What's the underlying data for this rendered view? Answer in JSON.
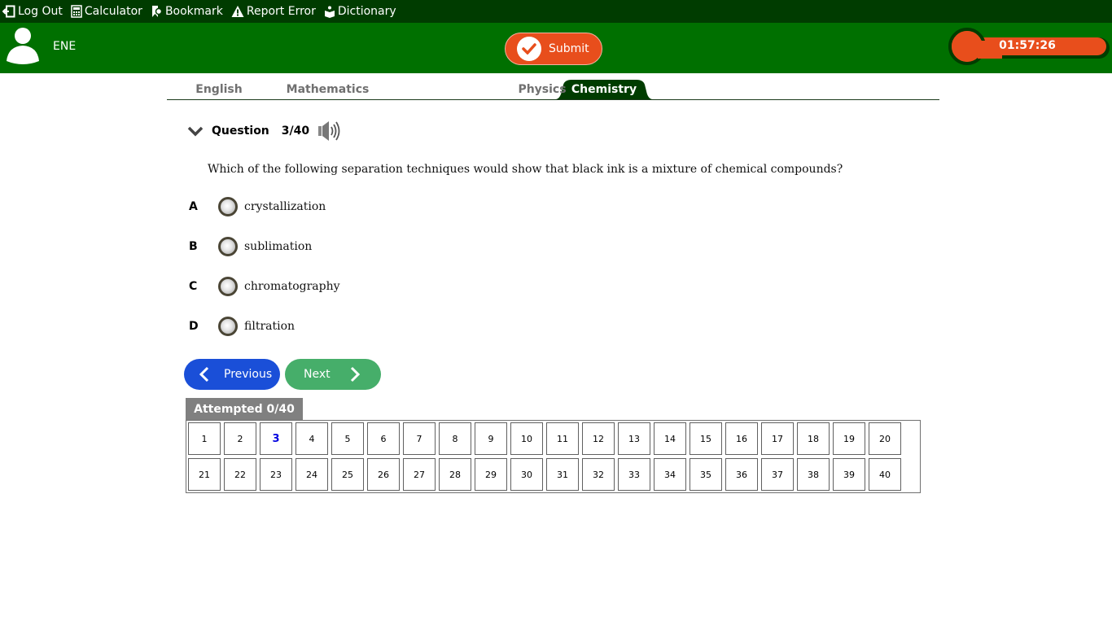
{
  "toolbar": {
    "items": [
      {
        "label": "Log Out",
        "icon": "logout-icon"
      },
      {
        "label": "Calculator",
        "icon": "calculator-icon"
      },
      {
        "label": "Bookmark",
        "icon": "bookmark-icon"
      },
      {
        "label": "Report Error",
        "icon": "warning-icon"
      },
      {
        "label": "Dictionary",
        "icon": "dictionary-icon"
      }
    ]
  },
  "header": {
    "username": "ENE",
    "submit_label": "Submit",
    "timer": "01:57:26",
    "colors": {
      "header_bg": "#007000",
      "toolbar_bg": "#003c00",
      "accent": "#e84e1c"
    }
  },
  "tabs": [
    {
      "label": "English",
      "active": false
    },
    {
      "label": "Mathematics",
      "active": false
    },
    {
      "label": "Chemistry",
      "active": true
    },
    {
      "label": "Physics",
      "active": false
    }
  ],
  "question": {
    "label": "Question",
    "number": "3/40",
    "text": "Which of the following separation techniques would show that black ink is a mixture of chemical compounds?",
    "options": [
      {
        "letter": "A",
        "text": "crystallization",
        "selected": false
      },
      {
        "letter": "B",
        "text": "sublimation",
        "selected": false
      },
      {
        "letter": "C",
        "text": "chromatography",
        "selected": false
      },
      {
        "letter": "D",
        "text": "filtration",
        "selected": false
      }
    ]
  },
  "navigation": {
    "previous_label": "Previous",
    "next_label": "Next"
  },
  "attempted": {
    "label": "Attempted 0/40",
    "current": 3,
    "numbers": [
      "1",
      "2",
      "3",
      "4",
      "5",
      "6",
      "7",
      "8",
      "9",
      "10",
      "11",
      "12",
      "13",
      "14",
      "15",
      "16",
      "17",
      "18",
      "19",
      "20",
      "21",
      "22",
      "23",
      "24",
      "25",
      "26",
      "27",
      "28",
      "29",
      "30",
      "31",
      "32",
      "33",
      "34",
      "35",
      "36",
      "37",
      "38",
      "39",
      "40"
    ]
  }
}
